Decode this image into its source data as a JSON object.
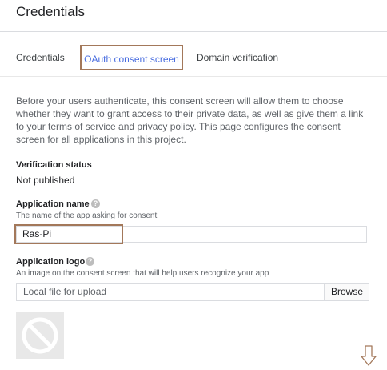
{
  "header": {
    "title": "Credentials"
  },
  "tabs": [
    {
      "label": "Credentials"
    },
    {
      "label": "OAuth consent screen"
    },
    {
      "label": "Domain verification"
    }
  ],
  "description": "Before your users authenticate, this consent screen will allow them to choose whether they want to grant access to their private data, as well as give them a link to your terms of service and privacy policy. This page configures the consent screen for all applications in this project.",
  "verification": {
    "label": "Verification status",
    "value": "Not published"
  },
  "app_name": {
    "label": "Application name",
    "hint": "The name of the app asking for consent",
    "value": "Ras-Pi"
  },
  "app_logo": {
    "label": "Application logo",
    "hint": "An image on the consent screen that will help users recognize your app",
    "file_placeholder": "Local file for upload",
    "browse_label": "Browse"
  },
  "icons": {
    "help": "question-mark-circle",
    "no_logo": "no-symbol",
    "arrow": "down-arrow"
  },
  "colors": {
    "active_tab": "#4a6ee0",
    "highlight_border": "#a3785a"
  }
}
